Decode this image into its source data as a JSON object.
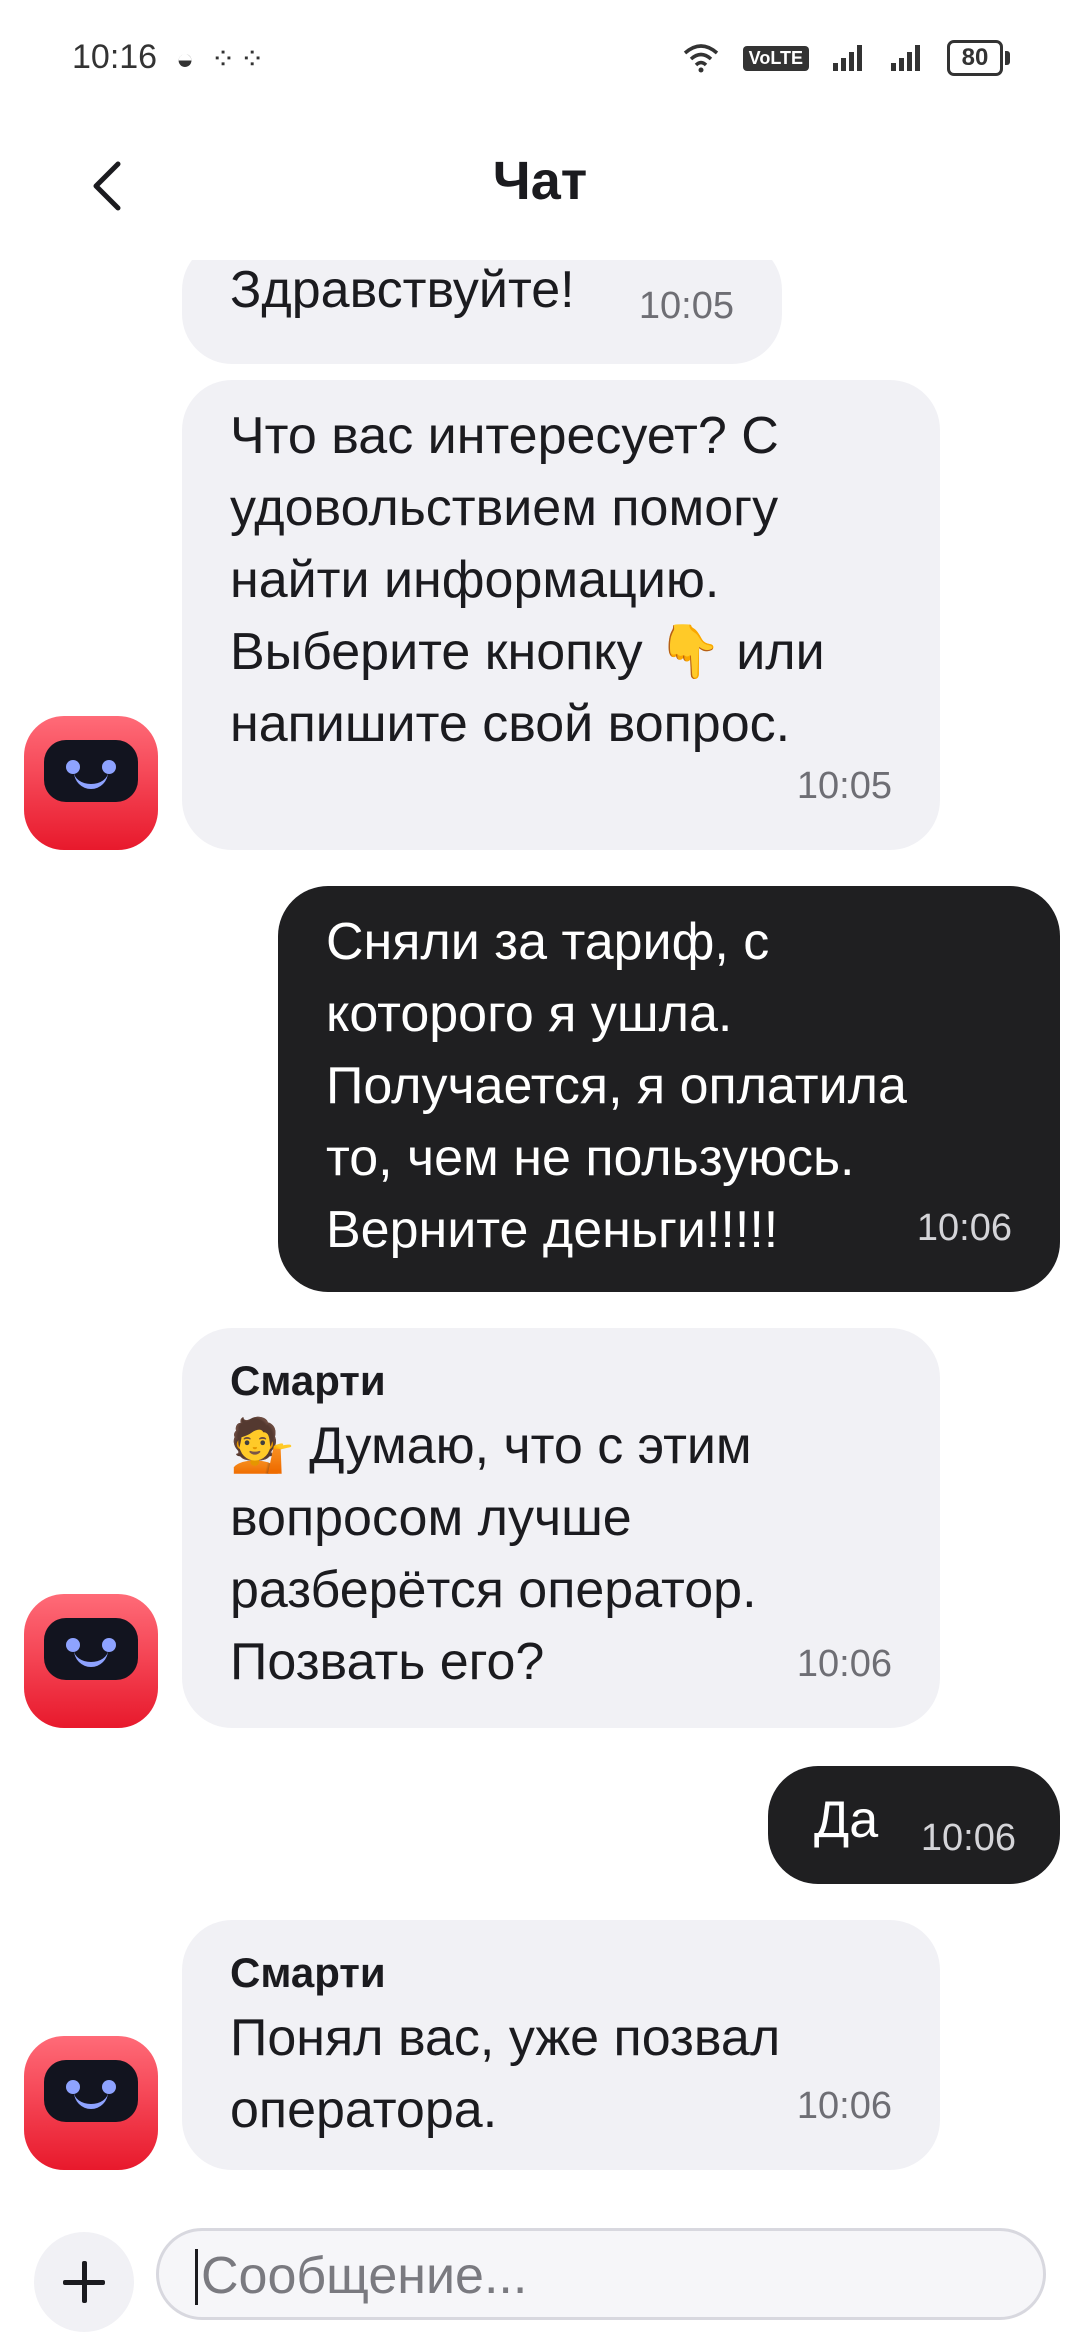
{
  "status_bar": {
    "time": "10:16",
    "left_icons": "◒ ⁘⁘",
    "volte": "VoLTE",
    "battery": "80"
  },
  "header": {
    "title": "Чат"
  },
  "messages": [
    {
      "from": "bot",
      "text": "Здравствуйте!",
      "time": "10:05"
    },
    {
      "from": "bot",
      "text": "Что вас интересует? С удовольствием помогу найти информацию. Выберите кнопку 👇 или напишите свой вопрос.",
      "time": "10:05"
    },
    {
      "from": "user",
      "text": "Сняли за тариф, с которого я ушла. Получается, я оплатила то, чем не пользуюсь. Верните деньги!!!!!",
      "time": "10:06"
    },
    {
      "from": "bot",
      "sender": "Смарти",
      "text": "💁 Думаю, что с этим вопросом лучше разберётся оператор. Позвать его?",
      "time": "10:06"
    },
    {
      "from": "user",
      "text": "Да",
      "time": "10:06"
    },
    {
      "from": "bot",
      "sender": "Смарти",
      "text": "Понял вас, уже позвал оператора.",
      "time": "10:06"
    }
  ],
  "input": {
    "placeholder": "Сообщение..."
  },
  "colors": {
    "bot_bubble": "#f1f1f5",
    "user_bubble": "#1f1f21",
    "avatar": "#e8192c"
  }
}
